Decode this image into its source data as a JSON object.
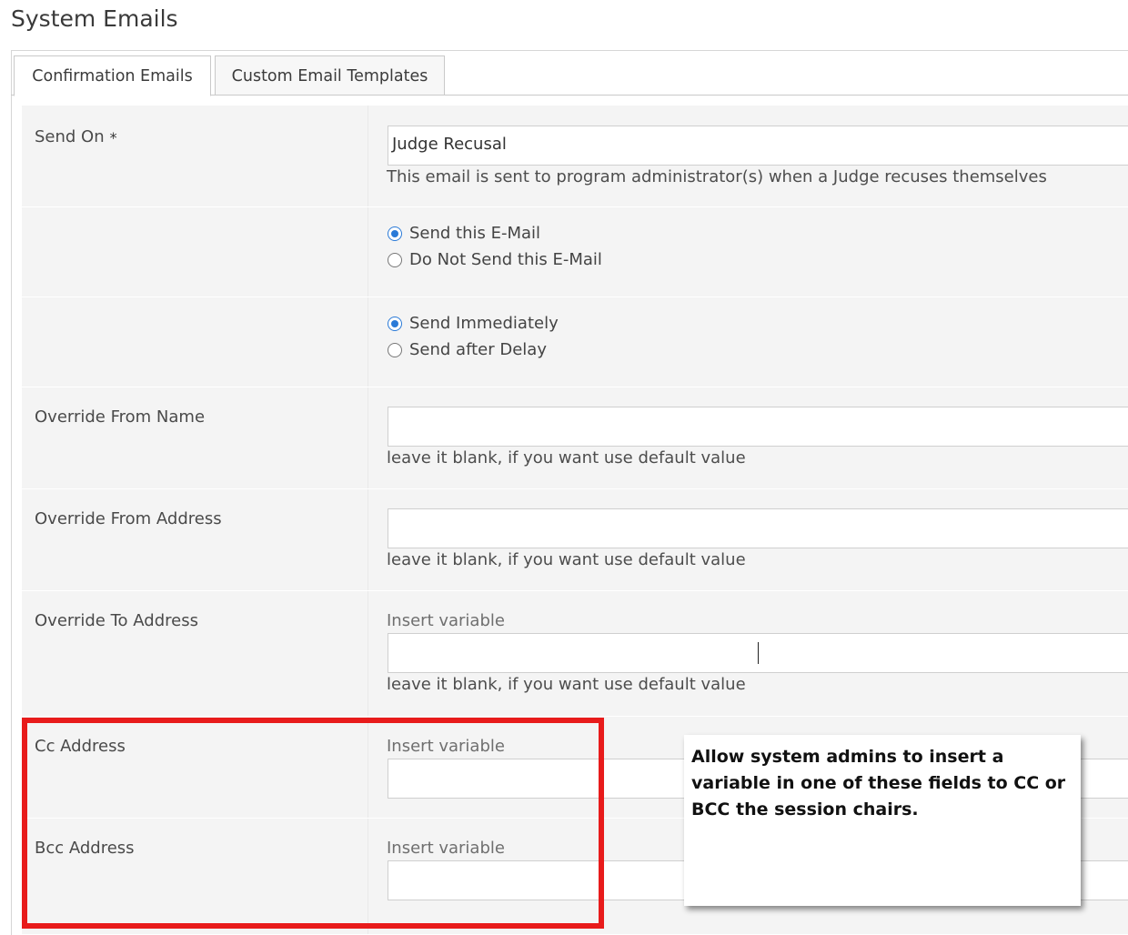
{
  "page_title": "System Emails",
  "tabs": [
    {
      "label": "Confirmation Emails",
      "active": true
    },
    {
      "label": "Custom Email Templates",
      "active": false
    }
  ],
  "form": {
    "send_on": {
      "label": "Send On",
      "required_marker": "*",
      "value": "Judge Recusal",
      "help": "This email is sent to program administrator(s) when a Judge recuses themselves"
    },
    "send_toggle": {
      "options": [
        {
          "label": "Send this E-Mail",
          "selected": true
        },
        {
          "label": "Do Not Send this E-Mail",
          "selected": false
        }
      ]
    },
    "timing": {
      "options": [
        {
          "label": "Send Immediately",
          "selected": true
        },
        {
          "label": "Send after Delay",
          "selected": false
        }
      ]
    },
    "override_from_name": {
      "label": "Override From Name",
      "value": "",
      "help": "leave it blank, if you want use default value"
    },
    "override_from_address": {
      "label": "Override From Address",
      "value": "",
      "help": "leave it blank, if you want use default value"
    },
    "override_to_address": {
      "label": "Override To Address",
      "insert_variable": "Insert variable",
      "value": "",
      "help": "leave it blank, if you want use default value"
    },
    "cc_address": {
      "label": "Cc Address",
      "insert_variable": "Insert variable",
      "value": ""
    },
    "bcc_address": {
      "label": "Bcc Address",
      "insert_variable": "Insert variable",
      "value": ""
    }
  },
  "annotation": {
    "text": "Allow system admins to insert a variable in one of these fields to CC or BCC the session chairs.",
    "highlight_color": "#e81b1b"
  }
}
